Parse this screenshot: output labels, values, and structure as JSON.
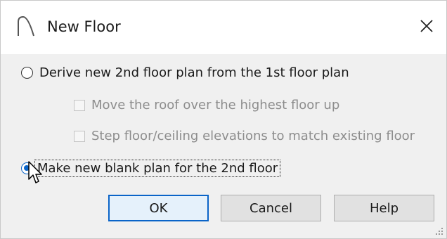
{
  "window": {
    "title": "New Floor",
    "icon": "arch-icon",
    "close": "close-icon"
  },
  "options": {
    "derive_label": "Derive new 2nd floor plan from the 1st floor plan",
    "move_roof_label": "Move the roof over the highest floor up",
    "step_floor_label": "Step floor/ceiling elevations to match existing floor",
    "blank_label": "Make new blank plan for the 2nd floor",
    "selected": "blank"
  },
  "buttons": {
    "ok": "OK",
    "cancel": "Cancel",
    "help": "Help"
  },
  "colors": {
    "accent": "#0a64c8",
    "dialog_bg": "#f0f0f0",
    "disabled_text": "#8d8d8d"
  }
}
